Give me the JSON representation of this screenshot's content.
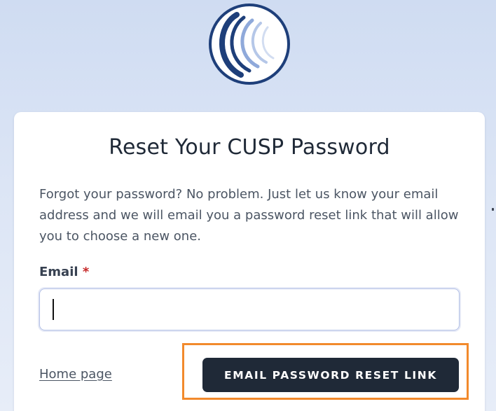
{
  "logo": {
    "icon": "cusp-logo-icon",
    "primary_color": "#1e3f7a",
    "secondary_color": "#8fa9da"
  },
  "card": {
    "title": "Reset Your CUSP Password",
    "description": "Forgot your password? No problem. Just let us know your email address and we will email you a password reset link that will allow you to choose a new one."
  },
  "form": {
    "email_label": "Email",
    "required_marker": "*",
    "email_value": "",
    "email_placeholder": ""
  },
  "actions": {
    "home_link": "Home page",
    "submit_label": "EMAIL PASSWORD RESET LINK"
  },
  "colors": {
    "button_bg": "#1f2937",
    "highlight": "#f28a2c",
    "required": "#c62828",
    "input_border": "#b4c1e6"
  }
}
